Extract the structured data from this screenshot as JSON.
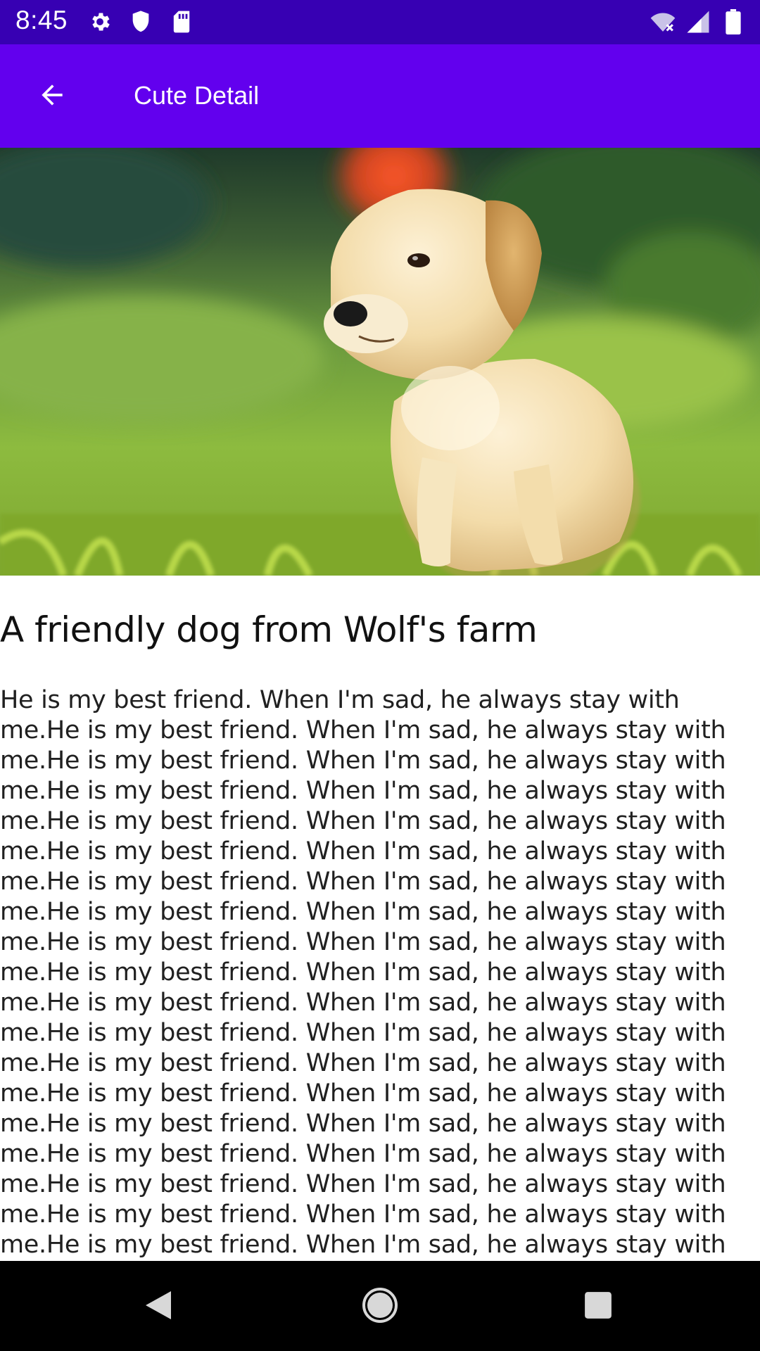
{
  "status_bar": {
    "time": "8:45",
    "left_icons": [
      "gear-icon",
      "shield-icon",
      "sd-card-icon"
    ],
    "right_icons": [
      "wifi-off-icon",
      "signal-icon",
      "battery-icon"
    ]
  },
  "app_bar": {
    "title": "Cute Detail",
    "background": "#6200ee",
    "status_background": "#3700b3"
  },
  "hero_image": {
    "subject": "puppy-on-grass"
  },
  "detail": {
    "title": "A friendly dog from Wolf's farm",
    "body": "He is my best friend. When I'm sad, he always stay with me.He is my best friend. When I'm sad, he always stay with me.He is my best friend. When I'm sad, he always stay with me.He is my best friend. When I'm sad, he always stay with me.He is my best friend. When I'm sad, he always stay with me.He is my best friend. When I'm sad, he always stay with me.He is my best friend. When I'm sad, he always stay with me.He is my best friend. When I'm sad, he always stay with me.He is my best friend. When I'm sad, he always stay with me.He is my best friend. When I'm sad, he always stay with me.He is my best friend. When I'm sad, he always stay with me.He is my best friend. When I'm sad, he always stay with me.He is my best friend. When I'm sad, he always stay with me.He is my best friend. When I'm sad, he always stay with me.He is my best friend. When I'm sad, he always stay with me.He is my best friend. When I'm sad, he always stay with me.He is my best friend. When I'm sad, he always stay with me.He is my best friend. When I'm sad, he always stay with me.He is my best friend. When I'm sad, he always stay with me.He is my"
  },
  "nav_bar": {
    "buttons": [
      "back-triangle-icon",
      "home-circle-icon",
      "recents-square-icon"
    ]
  }
}
